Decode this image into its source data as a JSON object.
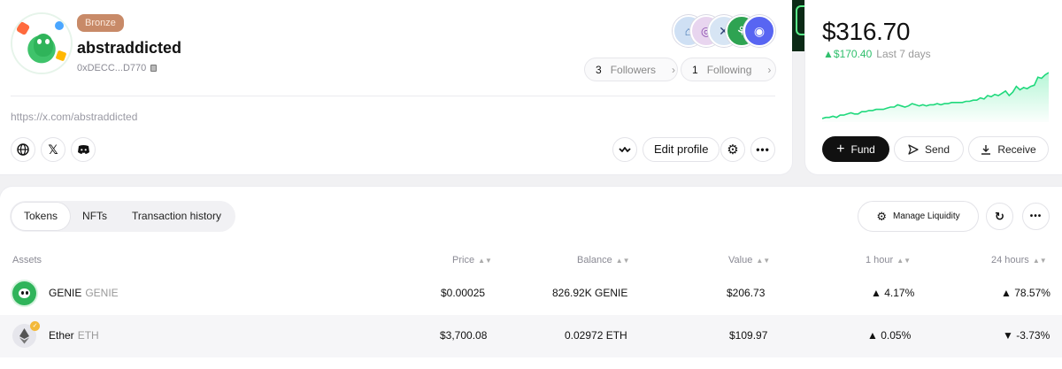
{
  "profile": {
    "tier": "Bronze",
    "username": "abstraddicted",
    "address": "0xDECC...D770",
    "followers_count": "3",
    "followers_label": "Followers",
    "following_count": "1",
    "following_label": "Following",
    "x_link": "https://x.com/abstraddicted",
    "edit_label": "Edit profile"
  },
  "wallet": {
    "balance": "$316.70",
    "change": "$170.40",
    "period": "Last 7 days",
    "fund_label": "Fund",
    "send_label": "Send",
    "receive_label": "Receive",
    "sparkline": [
      2,
      3,
      3,
      4,
      3,
      5,
      5,
      6,
      7,
      6,
      6,
      8,
      8,
      9,
      9,
      10,
      10,
      10,
      11,
      12,
      12,
      14,
      13,
      12,
      13,
      15,
      14,
      13,
      14,
      13,
      14,
      14,
      15,
      14,
      15,
      15,
      16,
      16,
      16,
      16,
      17,
      17,
      18,
      18,
      20,
      19,
      22,
      21,
      23,
      22,
      24,
      26,
      22,
      25,
      30,
      27,
      29,
      28,
      30,
      31,
      38,
      37,
      40,
      42
    ]
  },
  "tokens": {
    "tabs": [
      "Tokens",
      "NFTs",
      "Transaction history"
    ],
    "manage_label": "Manage Liquidity",
    "headers": {
      "assets": "Assets",
      "price": "Price",
      "balance": "Balance",
      "value": "Value",
      "h1": "1 hour",
      "h24": "24 hours"
    },
    "rows": [
      {
        "name": "GENIE",
        "symbol": "GENIE",
        "price": "$0.00025",
        "balance": "826.92K GENIE",
        "value": "$206.73",
        "h1": "4.17%",
        "h24": "78.57%"
      },
      {
        "name": "Ether",
        "symbol": "ETH",
        "price": "$3,700.08",
        "balance": "0.02972 ETH",
        "value": "$109.97",
        "h1": "0.05%",
        "h24": "-3.73%"
      }
    ]
  },
  "colors": {
    "accent_green": "#2fbf6c",
    "negative_red": "#e8483f",
    "tier_bronze": "#c88a68"
  }
}
